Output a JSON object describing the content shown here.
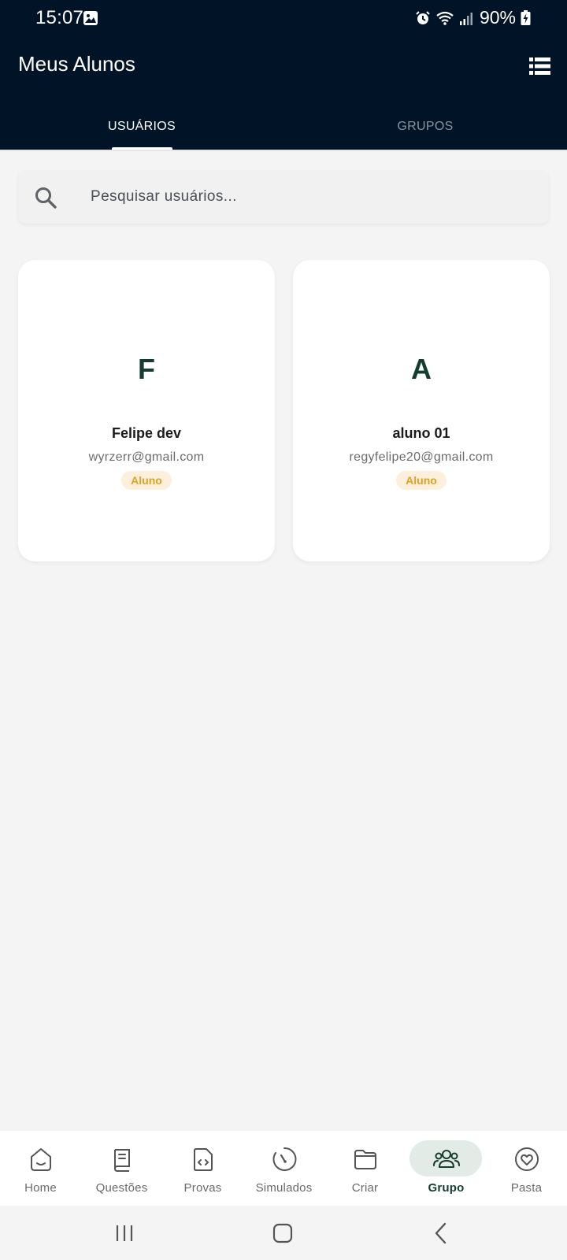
{
  "status_bar": {
    "time": "15:07",
    "battery": "90%"
  },
  "header": {
    "title": "Meus Alunos",
    "view_toggle_icon": "list-view-icon"
  },
  "tabs": [
    {
      "label": "USUÁRIOS",
      "active": true
    },
    {
      "label": "GRUPOS",
      "active": false
    }
  ],
  "search": {
    "placeholder": "Pesquisar usuários...",
    "value": ""
  },
  "users": [
    {
      "initial": "F",
      "name": "Felipe dev",
      "email": "wyrzerr@gmail.com",
      "role": "Aluno"
    },
    {
      "initial": "A",
      "name": "aluno 01",
      "email": "regyfelipe20@gmail.com",
      "role": "Aluno"
    }
  ],
  "bottom_nav": [
    {
      "label": "Home",
      "icon": "home-icon",
      "active": false
    },
    {
      "label": "Questões",
      "icon": "book-icon",
      "active": false
    },
    {
      "label": "Provas",
      "icon": "code-file-icon",
      "active": false
    },
    {
      "label": "Simulados",
      "icon": "timer-icon",
      "active": false
    },
    {
      "label": "Criar",
      "icon": "folder-icon",
      "active": false
    },
    {
      "label": "Grupo",
      "icon": "group-icon",
      "active": true
    },
    {
      "label": "Pasta",
      "icon": "heart-icon",
      "active": false
    }
  ],
  "colors": {
    "header_bg": "#011427",
    "accent_green": "#143d2f",
    "badge_bg": "#fcf0dc",
    "badge_text": "#e0a022",
    "active_pill": "#e3ebe7"
  }
}
